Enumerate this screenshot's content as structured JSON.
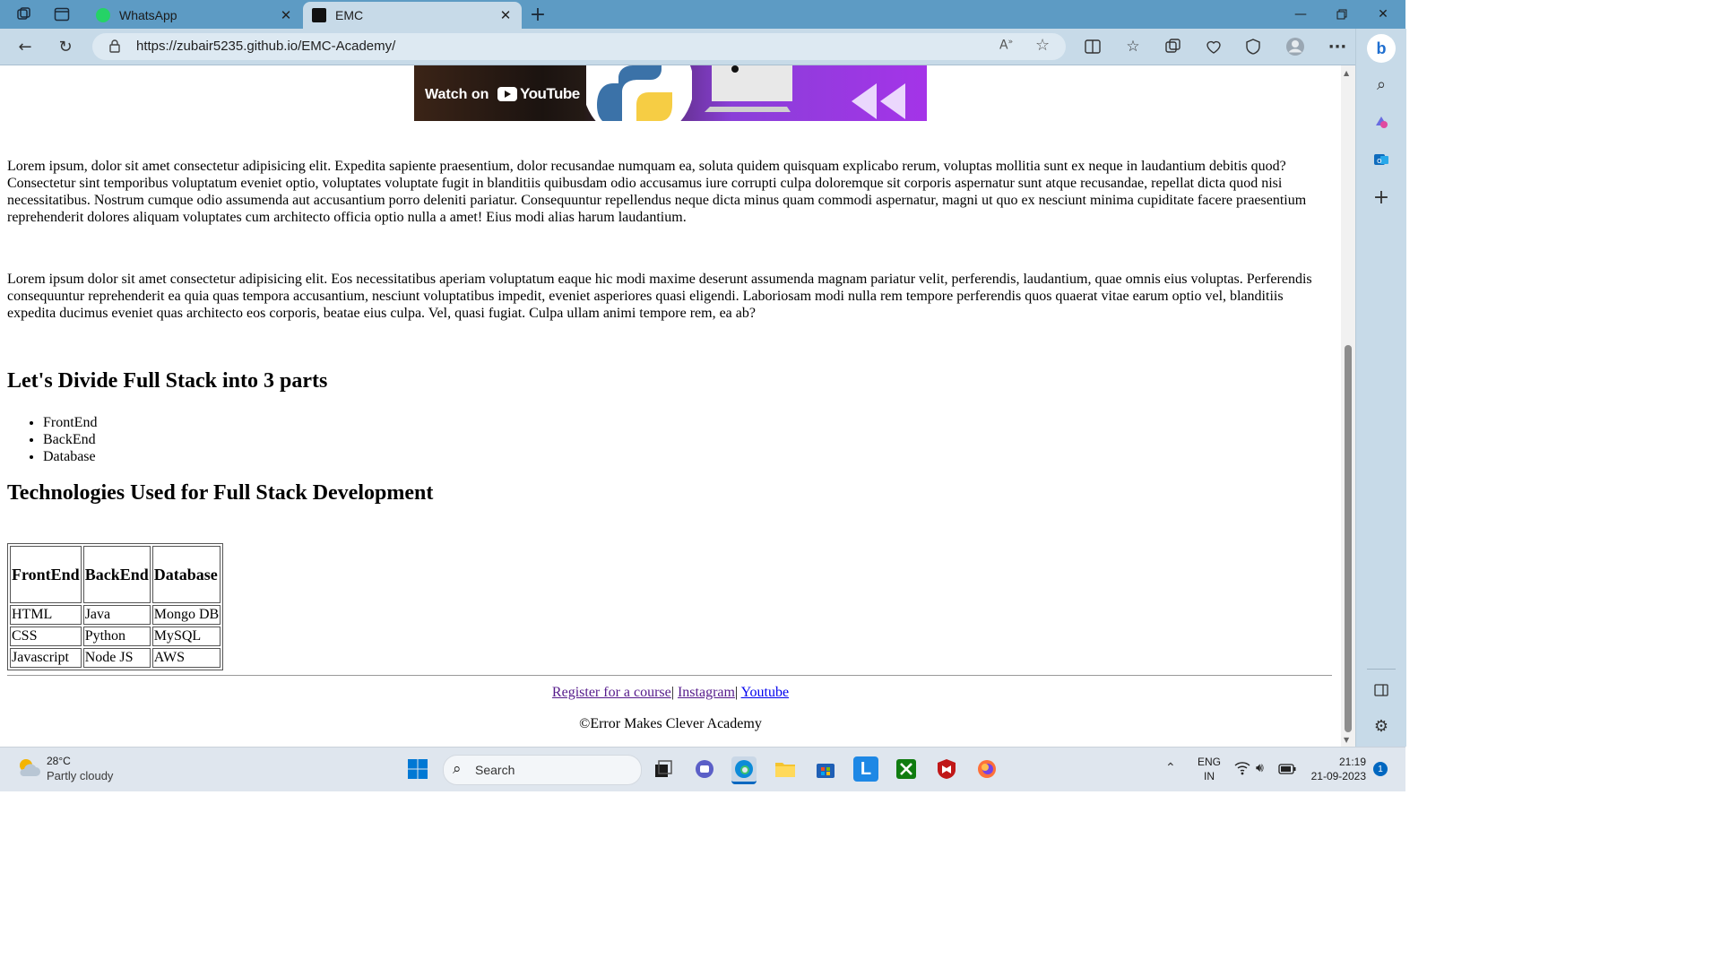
{
  "browser": {
    "tabs": [
      {
        "title": "WhatsApp"
      },
      {
        "title": "EMC"
      }
    ],
    "url": "https://zubair5235.github.io/EMC-Academy/",
    "reader_label": "A̅"
  },
  "page": {
    "banner": {
      "watch_on": "Watch on",
      "youtube": "YouTube"
    },
    "paragraph1": "Lorem ipsum, dolor sit amet consectetur adipisicing elit. Expedita sapiente praesentium, dolor recusandae numquam ea, soluta quidem quisquam explicabo rerum, voluptas mollitia sunt ex neque in laudantium debitis quod? Consectetur sint temporibus voluptatum eveniet optio, voluptates voluptate fugit in blanditiis quibusdam odio accusamus iure corrupti culpa doloremque sit corporis aspernatur sunt atque recusandae, repellat dicta quod nisi necessitatibus. Nostrum cumque odio assumenda aut accusantium porro deleniti pariatur. Consequuntur repellendus neque dicta minus quam commodi aspernatur, magni ut quo ex nesciunt minima cupiditate facere praesentium reprehenderit dolores aliquam voluptates cum architecto officia optio nulla a amet! Eius modi alias harum laudantium.",
    "paragraph2": "Lorem ipsum dolor sit amet consectetur adipisicing elit. Eos necessitatibus aperiam voluptatum eaque hic modi maxime deserunt assumenda magnam pariatur velit, perferendis, laudantium, quae omnis eius voluptas. Perferendis consequuntur reprehenderit ea quia quas tempora accusantium, nesciunt voluptatibus impedit, eveniet asperiores quasi eligendi. Laboriosam modi nulla rem tempore perferendis quos quaerat vitae earum optio vel, blanditiis expedita ducimus eveniet quas architecto eos corporis, beatae eius culpa. Vel, quasi fugiat. Culpa ullam animi tempore rem, ea ab?",
    "heading_parts": "Let's Divide Full Stack into 3 parts",
    "parts": [
      "FrontEnd",
      "BackEnd",
      "Database"
    ],
    "heading_tech": "Technologies Used for Full Stack Development",
    "table": {
      "headers": [
        "FrontEnd",
        "BackEnd",
        "Database"
      ],
      "rows": [
        [
          "HTML",
          "Java",
          "Mongo DB"
        ],
        [
          "CSS",
          "Python",
          "MySQL"
        ],
        [
          "Javascript",
          "Node JS",
          "AWS"
        ]
      ]
    },
    "footer": {
      "register_link": "Register for a course",
      "sep": "|",
      "instagram_link": "Instagram",
      "youtube_link": "Youtube",
      "copyright": "©Error Makes Clever Academy"
    }
  },
  "taskbar": {
    "weather_temp": "28°C",
    "weather_desc": "Partly cloudy",
    "search_label": "Search",
    "lang_top": "ENG",
    "lang_bottom": "IN",
    "time": "21:19",
    "date": "21-09-2023",
    "notification_count": "1"
  },
  "colors": {
    "titlebar": "#5d9bc4",
    "toolbar": "#c7dae8",
    "link_visited": "#551a8b",
    "link_unvisited": "#0000ee"
  }
}
